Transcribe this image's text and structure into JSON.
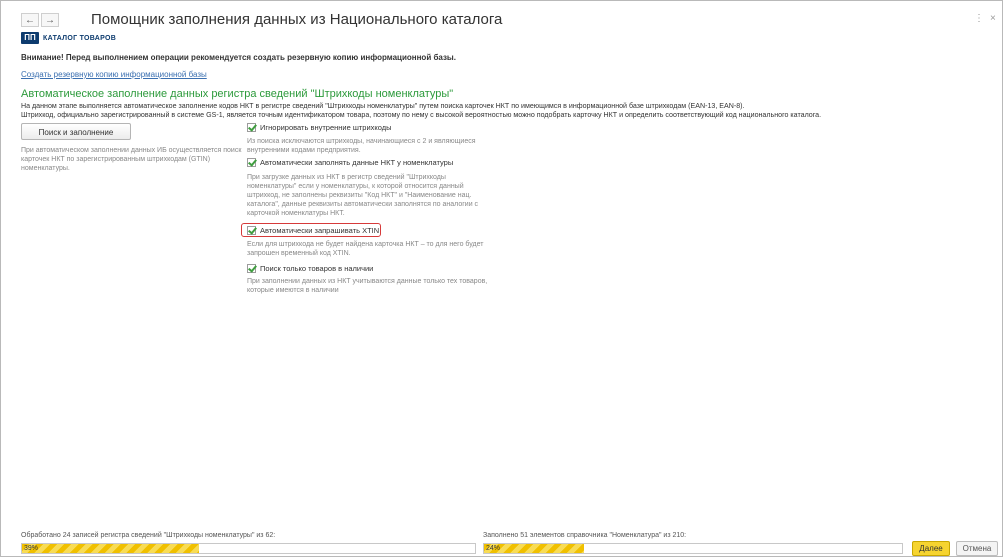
{
  "window": {
    "title": "Помощник заполнения данных из Национального каталога",
    "back_glyph": "←",
    "forward_glyph": "→",
    "menu_glyph": "⋮",
    "close_glyph": "×"
  },
  "logo": {
    "mark": "ПП",
    "text": "КАТАЛОГ ТОВАРОВ",
    "color": "#0d3b6e"
  },
  "warning_text": "Внимание! Перед выполнением операции рекомендуется создать резервную копию информационной базы.",
  "backup_link": "Создать резервную копию информационной базы",
  "section": {
    "title": "Автоматическое заполнение данных регистра сведений \"Штрихкоды номенклатуры\"",
    "desc_line1": "На данном этапе выполняется автоматическое заполнение кодов НКТ в регистре сведений \"Штрихкоды номенклатуры\"  путем поиска карточек НКТ по имеющимся в информационной базе штрихкодам (EAN-13, EAN-8).",
    "desc_line2": "Штрихкод, официально зарегистрированный в системе GS-1, является точным идентификатором товара, поэтому по нему с высокой вероятностью можно подобрать карточку НКТ и определить соответствующий код национального каталога."
  },
  "search_button": "Поиск и заполнение",
  "search_hint": "При автоматическом заполнении данных ИБ осуществляется поиск карточек НКТ по зарегистрированным штрихкодам (GTIN) номенклатуры.",
  "options": [
    {
      "label": "Игнорировать внутренние штрихкоды",
      "checked": true,
      "hint": "Из поиска исключаются штрихкоды, начинающиеся с 2 и являющиеся внутренними кодами предприятия."
    },
    {
      "label": "Автоматически заполнять данные НКТ у номенклатуры",
      "checked": true,
      "hint": "При загрузке данных из НКТ в регистр сведений \"Штрихкоды номенклатуры\" если у номенклатуры, к которой относится данный штрихкод, не заполнены реквизиты \"Код НКТ\" и \"Наименование нац. каталога\", данные реквизиты автоматически заполнятся по аналогии с карточкой номенклатуры НКТ."
    },
    {
      "label": "Автоматически запрашивать XTIN",
      "checked": true,
      "hint": "Если для штрихкода не будет найдена карточка НКТ – то для него будет запрошен временный код XTIN."
    },
    {
      "label": "Поиск только товаров в наличии",
      "checked": true,
      "hint": "При заполнении данных из НКТ учитываются данные только тех товаров, которые имеются в наличии"
    }
  ],
  "progress": [
    {
      "label": "Обработано 24 записей регистра сведений \"Штрихкоды номенклатуры\" из 62:",
      "text": "39%",
      "value": 0.39
    },
    {
      "label": "Заполнено 51 элементов справочника \"Номенклатура\" из 210:",
      "text": "24%",
      "value": 0.24
    }
  ],
  "buttons": {
    "next": "Далее",
    "cancel": "Отмена"
  },
  "colors": {
    "section_title": "#2c9a3b",
    "link": "#3a6fb0",
    "highlight": "#d63a3a",
    "accent": "#f6d430"
  }
}
